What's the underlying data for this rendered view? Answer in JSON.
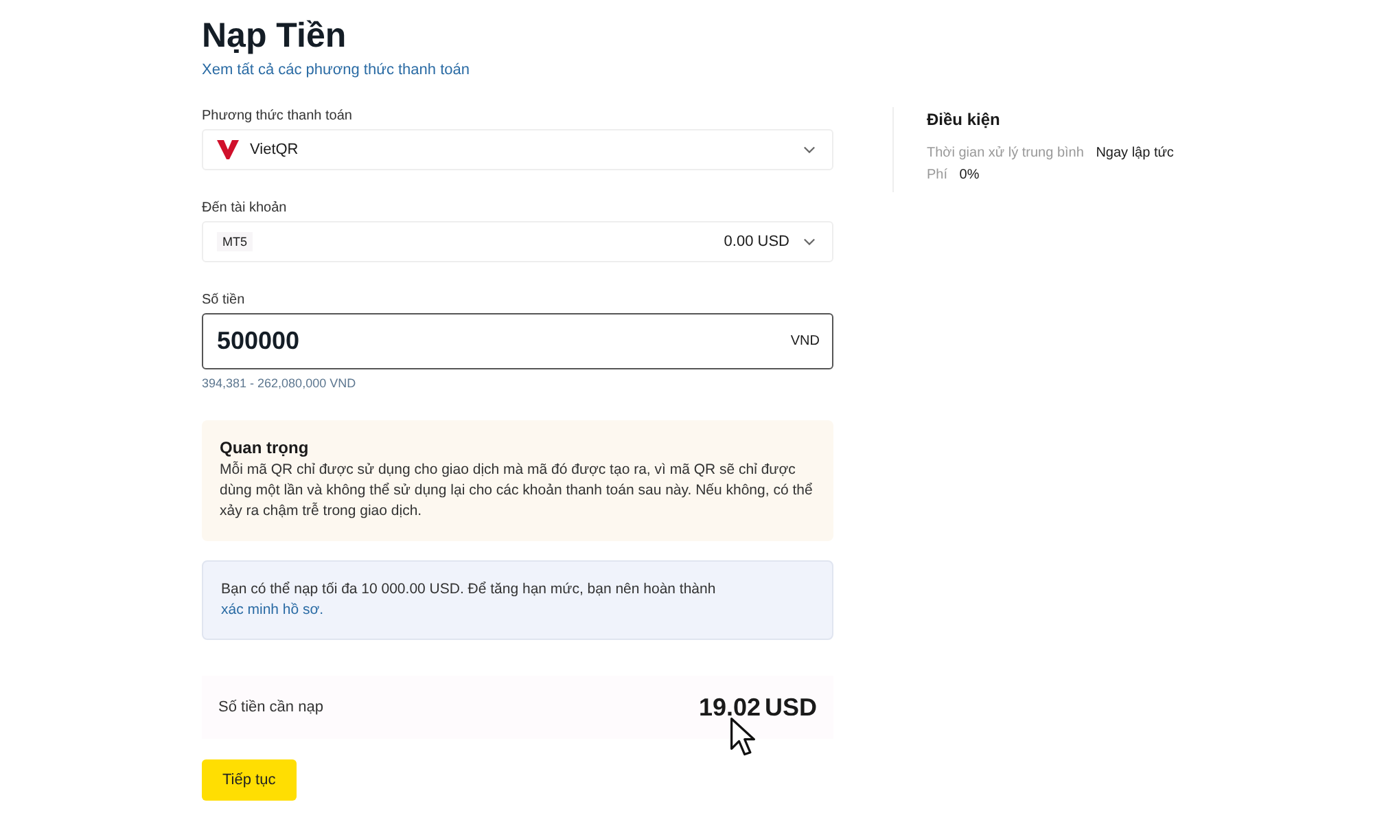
{
  "title": "Nạp Tiền",
  "all_methods_link": "Xem tất cả các phương thức thanh toán",
  "method": {
    "label": "Phương thức thanh toán",
    "value": "VietQR"
  },
  "account": {
    "label": "Đến tài khoản",
    "tag": "MT5",
    "balance": "0.00 USD"
  },
  "amount": {
    "label": "Số tiền",
    "value": "500000",
    "currency": "VND",
    "range": "394,381 - 262,080,000 VND"
  },
  "notice": {
    "title": "Quan trọng",
    "text": "Mỗi mã QR chỉ được sử dụng cho giao dịch mà mã đó được tạo ra, vì mã QR sẽ chỉ được dùng một lần và không thể sử dụng lại cho các khoản thanh toán sau này. Nếu không, có thể xảy ra chậm trễ trong giao dịch."
  },
  "limit": {
    "text": "Bạn có thể nạp tối đa 10 000.00 USD. Để tăng hạn mức, bạn nên hoàn thành",
    "link": "xác minh hồ sơ."
  },
  "total": {
    "label": "Số tiền cần nạp",
    "value": "19.02",
    "currency": "USD"
  },
  "continue_button": "Tiếp tục",
  "conditions": {
    "title": "Điều kiện",
    "rows": [
      {
        "label": "Thời gian xử lý trung bình",
        "value": "Ngay lập tức"
      },
      {
        "label": "Phí",
        "value": "0%"
      }
    ]
  }
}
